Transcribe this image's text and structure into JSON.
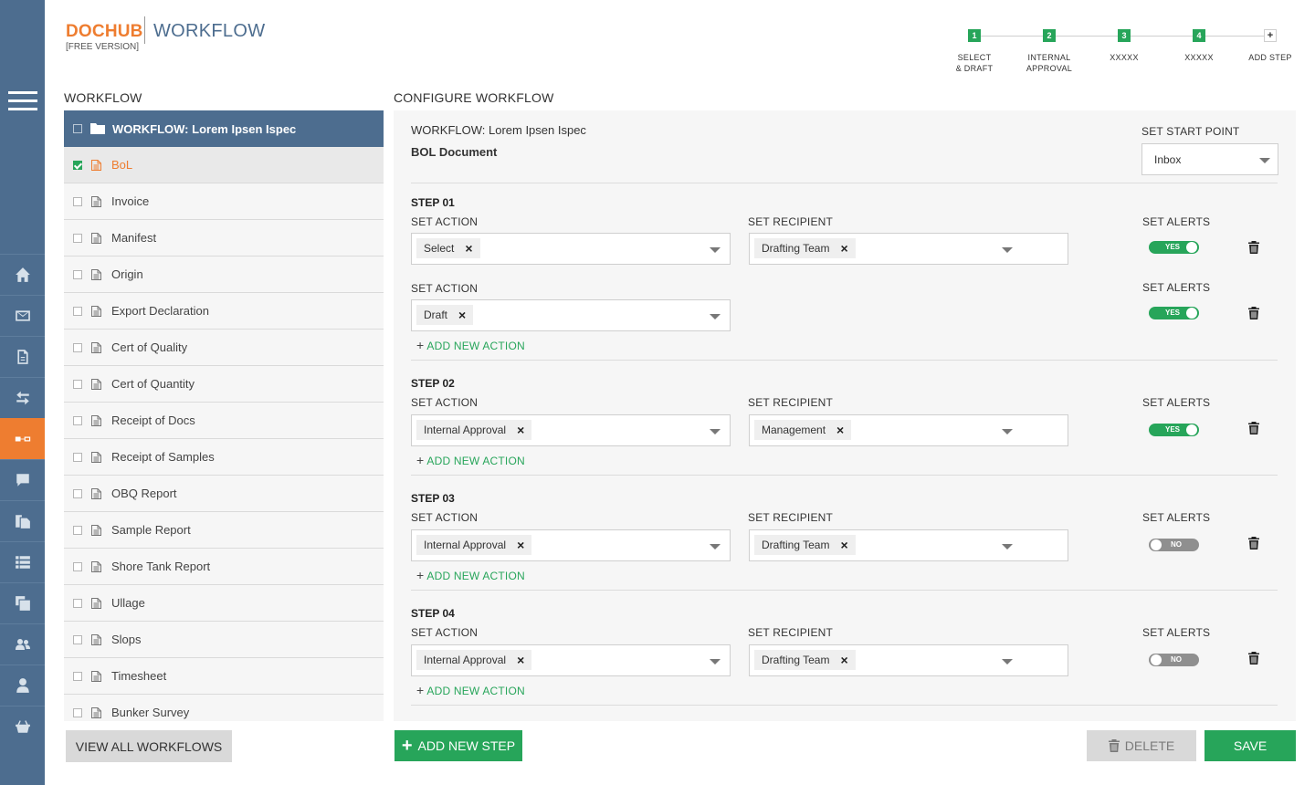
{
  "header": {
    "logo_brand": "DOCHUB",
    "logo_edition": "[FREE VERSION]",
    "logo_section": "WORKFLOW"
  },
  "steps_progress": [
    {
      "number": "1",
      "label_line1": "SELECT",
      "label_line2": "& DRAFT"
    },
    {
      "number": "2",
      "label_line1": "INTERNAL",
      "label_line2": "APPROVAL"
    },
    {
      "number": "3",
      "label_line1": "XXXXX",
      "label_line2": ""
    },
    {
      "number": "4",
      "label_line1": "XXXXX",
      "label_line2": ""
    },
    {
      "number": "+",
      "label_line1": "ADD STEP",
      "label_line2": ""
    }
  ],
  "sidebar": {
    "icons": [
      "menu-icon",
      "home-icon",
      "mail-icon",
      "document-icon",
      "transfer-icon",
      "workflow-icon",
      "chat-icon",
      "files-icon",
      "list-icon",
      "copy-icon",
      "users-icon",
      "user-icon",
      "basket-icon"
    ],
    "active": "workflow-icon"
  },
  "workflow_panel": {
    "title": "WORKFLOW",
    "header": "WORKFLOW: Lorem Ipsen Ispec",
    "items": [
      {
        "label": "BoL",
        "checked": true
      },
      {
        "label": "Invoice",
        "checked": false
      },
      {
        "label": "Manifest",
        "checked": false
      },
      {
        "label": "Origin",
        "checked": false
      },
      {
        "label": "Export Declaration",
        "checked": false
      },
      {
        "label": "Cert of Quality",
        "checked": false
      },
      {
        "label": "Cert of Quantity",
        "checked": false
      },
      {
        "label": "Receipt of Docs",
        "checked": false
      },
      {
        "label": "Receipt of Samples",
        "checked": false
      },
      {
        "label": "OBQ Report",
        "checked": false
      },
      {
        "label": "Sample Report",
        "checked": false
      },
      {
        "label": "Shore Tank Report",
        "checked": false
      },
      {
        "label": "Ullage",
        "checked": false
      },
      {
        "label": "Slops",
        "checked": false
      },
      {
        "label": "Timesheet",
        "checked": false
      },
      {
        "label": "Bunker Survey",
        "checked": false
      }
    ]
  },
  "config": {
    "title": "CONFIGURE WORKFLOW",
    "workflow_name": "WORKFLOW: Lorem Ipsen Ispec",
    "document_name": "BOL Document",
    "start_point_label": "SET START POINT",
    "start_point_value": "Inbox",
    "action_label": "SET ACTION",
    "recipient_label": "SET RECIPIENT",
    "alerts_label": "SET ALERTS",
    "add_action_label": "ADD NEW ACTION",
    "steps": [
      {
        "title": "STEP 01",
        "action": "Select",
        "recipient": "Drafting Team",
        "alerts": "YES",
        "extra_action": "Draft",
        "extra_alerts": "YES"
      },
      {
        "title": "STEP 02",
        "action": "Internal Approval",
        "recipient": "Management",
        "alerts": "YES"
      },
      {
        "title": "STEP 03",
        "action": "Internal Approval",
        "recipient": "Drafting Team",
        "alerts": "NO"
      },
      {
        "title": "STEP 04",
        "action": "Internal Approval",
        "recipient": "Drafting Team",
        "alerts": "NO"
      }
    ]
  },
  "footer": {
    "view_all": "VIEW ALL WORKFLOWS",
    "add_step": "ADD NEW STEP",
    "delete": "DELETE",
    "save": "SAVE"
  },
  "colors": {
    "sidebar": "#4d6d8f",
    "accent_orange": "#ee7d30",
    "accent_green": "#27a55a"
  }
}
